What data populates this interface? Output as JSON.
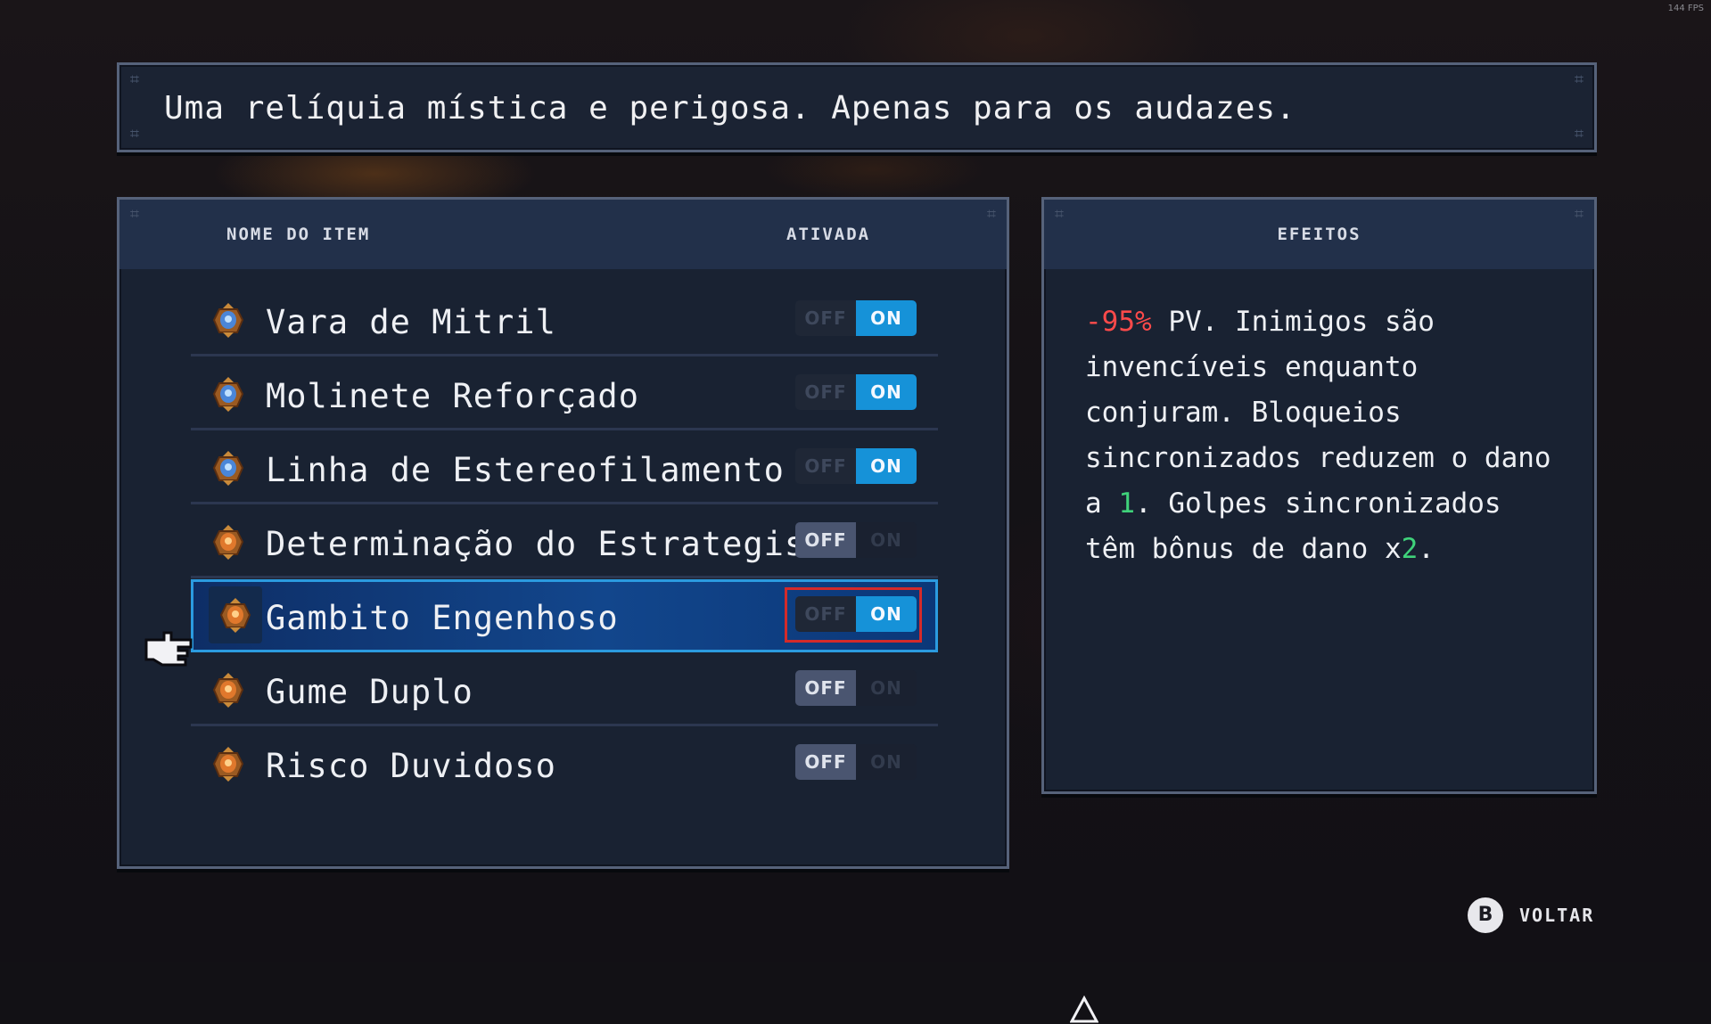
{
  "fps_counter": "144 FPS",
  "description": "Uma relíquia mística e perigosa. Apenas para os audazes.",
  "items_panel": {
    "header_name": "NOME DO ITEM",
    "header_active": "ATIVADA",
    "off_label": "OFF",
    "on_label": "ON",
    "items": [
      {
        "label": "Vara de Mitril",
        "state": "ON",
        "icon": "blue-relic-icon"
      },
      {
        "label": "Molinete Reforçado",
        "state": "ON",
        "icon": "blue-relic-icon"
      },
      {
        "label": "Linha de Estereofilamento",
        "state": "ON",
        "icon": "blue-relic-icon"
      },
      {
        "label": "Determinação do Estrategista",
        "state": "OFF",
        "icon": "orange-relic-icon"
      },
      {
        "label": "Gambito Engenhoso",
        "state": "ON",
        "icon": "orange-relic-icon",
        "selected": true
      },
      {
        "label": "Gume Duplo",
        "state": "OFF",
        "icon": "orange-relic-icon"
      },
      {
        "label": "Risco Duvidoso",
        "state": "OFF",
        "icon": "orange-relic-icon"
      }
    ]
  },
  "effects_panel": {
    "header": "EFEITOS",
    "text_parts": {
      "p1": "-95%",
      "p2": " PV. Inimigos são invencíveis enquanto conjuram. Bloqueios sincronizados reduzem o dano a ",
      "p3": "1",
      "p4": ". Golpes sincronizados têm bônus de dano x",
      "p5": "2",
      "p6": "."
    }
  },
  "back_button": {
    "key": "B",
    "label": "VOLTAR"
  },
  "colors": {
    "accent_on": "#1692d8",
    "selected_border": "#2b9be0",
    "focus_box": "#d42a2a",
    "negative": "#ff4a4a",
    "positive": "#3fd27a"
  }
}
